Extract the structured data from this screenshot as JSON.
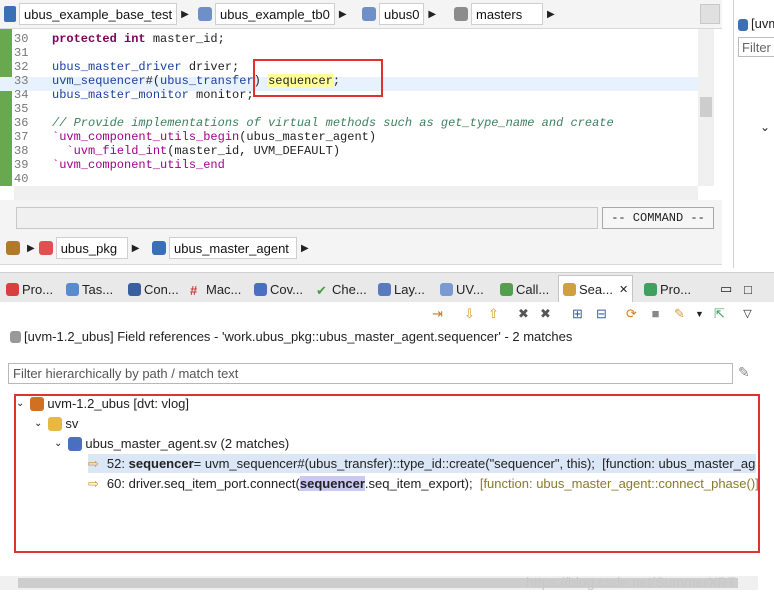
{
  "breadcrumb_top": {
    "items": [
      {
        "label": "ubus_example_base_test"
      },
      {
        "label": "ubus_example_tb0"
      },
      {
        "label": "ubus0"
      },
      {
        "label": "masters"
      }
    ]
  },
  "editor": {
    "lines": [
      {
        "num": "30",
        "text": "protected int master_id;"
      },
      {
        "num": "31",
        "text": ""
      },
      {
        "num": "32",
        "text": "ubus_master_driver driver;"
      },
      {
        "num": "33",
        "text": "uvm_sequencer#(ubus_transfer) sequencer;"
      },
      {
        "num": "34",
        "text": "ubus_master_monitor monitor;"
      },
      {
        "num": "35",
        "text": ""
      },
      {
        "num": "36",
        "text": "// Provide implementations of virtual methods such as get_type_name and create"
      },
      {
        "num": "37",
        "text": "`uvm_component_utils_begin(ubus_master_agent)"
      },
      {
        "num": "38",
        "text": "  `uvm_field_int(master_id, UVM_DEFAULT)"
      },
      {
        "num": "39",
        "text": "`uvm_component_utils_end"
      },
      {
        "num": "40",
        "text": ""
      }
    ]
  },
  "command_button": "-- COMMAND --",
  "breadcrumb_bottom": {
    "items": [
      {
        "label": "ubus_pkg"
      },
      {
        "label": "ubus_master_agent"
      }
    ]
  },
  "right_panel": {
    "label": "[uvm",
    "filter": "Filter"
  },
  "view_tabs": [
    {
      "label": "Pro..."
    },
    {
      "label": "Tas..."
    },
    {
      "label": "Con..."
    },
    {
      "label": "Mac..."
    },
    {
      "label": "Cov..."
    },
    {
      "label": "Che..."
    },
    {
      "label": "Lay..."
    },
    {
      "label": "UV..."
    },
    {
      "label": "Call..."
    },
    {
      "label": "Sea..."
    },
    {
      "label": "Pro..."
    }
  ],
  "search": {
    "summary": "[uvm-1.2_ubus] Field references - 'work.ubus_pkg::ubus_master_agent.sequencer' - 2 matches",
    "filter_placeholder": "Filter hierarchically by path / match text",
    "tree": {
      "root": "uvm-1.2_ubus [dvt: vlog]",
      "folder": "sv",
      "file": "ubus_master_agent.sv (2 matches)",
      "matches": [
        {
          "line": "52:",
          "match": "sequencer",
          "rest": " = uvm_sequencer#(ubus_transfer)::type_id::create(\"sequencer\", this);",
          "context": "[function: ubus_master_age"
        },
        {
          "line": "60:",
          "pre": "driver.seq_item_port.connect(",
          "match": "sequencer",
          "rest": ".seq_item_export);",
          "context": "[function: ubus_master_agent::connect_phase()]"
        }
      ]
    }
  },
  "watermark": "https://blog.csdn.net/SummerXRT",
  "colors": {
    "highlight_box": "#e03030",
    "gutter": "#6aa84f",
    "match_bg": "#c9c9f2"
  }
}
